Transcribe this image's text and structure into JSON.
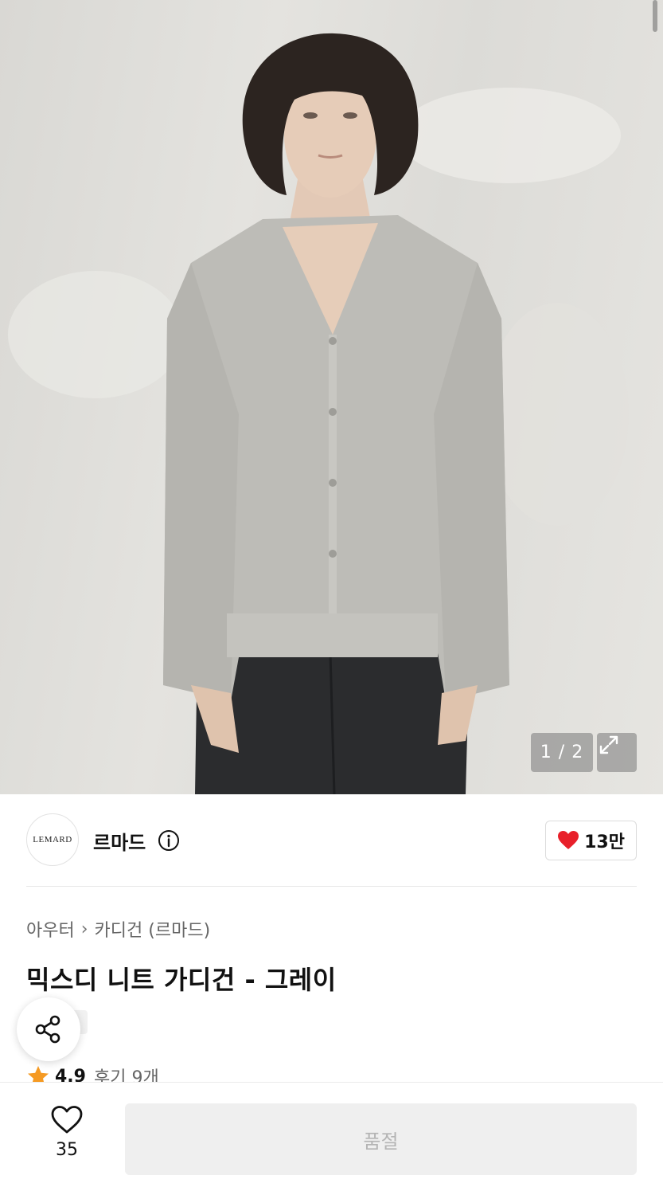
{
  "gallery": {
    "counter": "1 / 2",
    "image_alt": "model wearing grey mixed knit cardigan"
  },
  "brand": {
    "logo_text": "LEMARD",
    "name": "르마드",
    "like_count": "13만",
    "heart_color": "#e8202a"
  },
  "breadcrumb": {
    "category": "아우터",
    "separator": "›",
    "subcategory": "카디건 (르마드)"
  },
  "product": {
    "title": "믹스디 니트 가디건 - 그레이",
    "rating": "4.9",
    "reviews": "후기 9개",
    "star_color": "#f59a23"
  },
  "bottom_bar": {
    "wish_count": "35",
    "buy_label": "품절"
  }
}
